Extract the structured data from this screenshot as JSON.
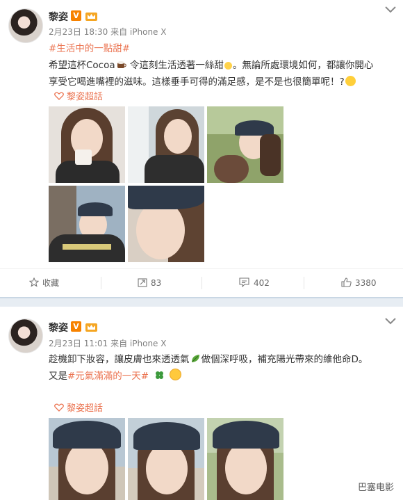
{
  "post1": {
    "username": "黎姿",
    "verified_badge": "V",
    "meta": "2月23日 18:30 来自 iPhone X",
    "hashtag": "#生活中的一點甜#",
    "text_a": "希望這杯Cocoa",
    "text_b": " 令這刻生活透著一絲甜",
    "text_c": "。無論所處環境如何，都讓你開心享受它喝進嘴裡的滋味。這樣垂手可得的滿足感，是不是也很簡單呢！?",
    "super_topic": "黎姿超話",
    "photo_count": 5,
    "actions": {
      "favorite_label": "收藏",
      "repost_count": "83",
      "comment_count": "402",
      "like_count": "3380"
    }
  },
  "post2": {
    "username": "黎姿",
    "verified_badge": "V",
    "meta": "2月23日 11:01 来自 iPhone X",
    "text_a": "趁機卸下妝容，讓皮膚也來透透氣",
    "text_b": "做個深呼吸，補充陽光帶來的維他命D。又是",
    "hashtag": "#元氣滿滿的一天#",
    "super_topic": "黎姿超話",
    "photo_count": 3
  },
  "watermark": "巴塞电影",
  "colors": {
    "link": "#eb7350",
    "meta_gray": "#808080",
    "badge_orange": "#f78200",
    "divider_blue": "#e7edf3"
  },
  "icons": [
    "chevron-down-icon",
    "crown-icon",
    "star-icon",
    "repost-icon",
    "comment-icon",
    "like-icon",
    "super-topic-icon"
  ]
}
